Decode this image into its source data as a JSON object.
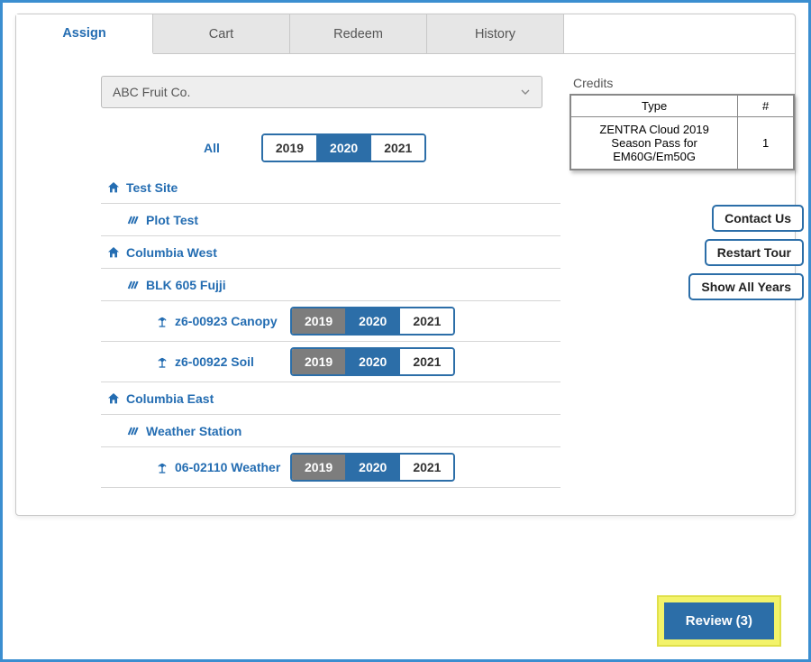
{
  "tabs": {
    "assign": "Assign",
    "cart": "Cart",
    "redeem": "Redeem",
    "history": "History",
    "active": "assign"
  },
  "org": {
    "selected": "ABC Fruit Co."
  },
  "years": {
    "all_label": "All",
    "options": [
      "2019",
      "2020",
      "2021"
    ],
    "selected": "2020"
  },
  "tree": [
    {
      "level": 1,
      "icon": "home",
      "label": "Test Site"
    },
    {
      "level": 2,
      "icon": "plot",
      "label": "Plot Test"
    },
    {
      "level": 1,
      "icon": "home",
      "label": "Columbia West"
    },
    {
      "level": 2,
      "icon": "plot",
      "label": "BLK 605 Fujji"
    },
    {
      "level": 3,
      "icon": "sensor",
      "label": "z6-00923 Canopy",
      "years": {
        "disabled": [
          "2019"
        ],
        "selected": "2020",
        "enabled": [
          "2021"
        ]
      }
    },
    {
      "level": 3,
      "icon": "sensor",
      "label": "z6-00922 Soil",
      "years": {
        "disabled": [
          "2019"
        ],
        "selected": "2020",
        "enabled": [
          "2021"
        ]
      }
    },
    {
      "level": 1,
      "icon": "home",
      "label": "Columbia East"
    },
    {
      "level": 2,
      "icon": "plot",
      "label": "Weather Station"
    },
    {
      "level": 3,
      "icon": "sensor",
      "label": "06-02110 Weather",
      "years": {
        "disabled": [
          "2019"
        ],
        "selected": "2020",
        "enabled": [
          "2021"
        ]
      }
    }
  ],
  "credits": {
    "title": "Credits",
    "headers": {
      "type": "Type",
      "count": "#"
    },
    "rows": [
      {
        "type": "ZENTRA Cloud 2019 Season Pass for EM60G/Em50G",
        "count": "1"
      }
    ]
  },
  "sidebuttons": {
    "contact": "Contact Us",
    "restart": "Restart Tour",
    "allyears": "Show All Years"
  },
  "review": {
    "label": "Review (3)"
  }
}
